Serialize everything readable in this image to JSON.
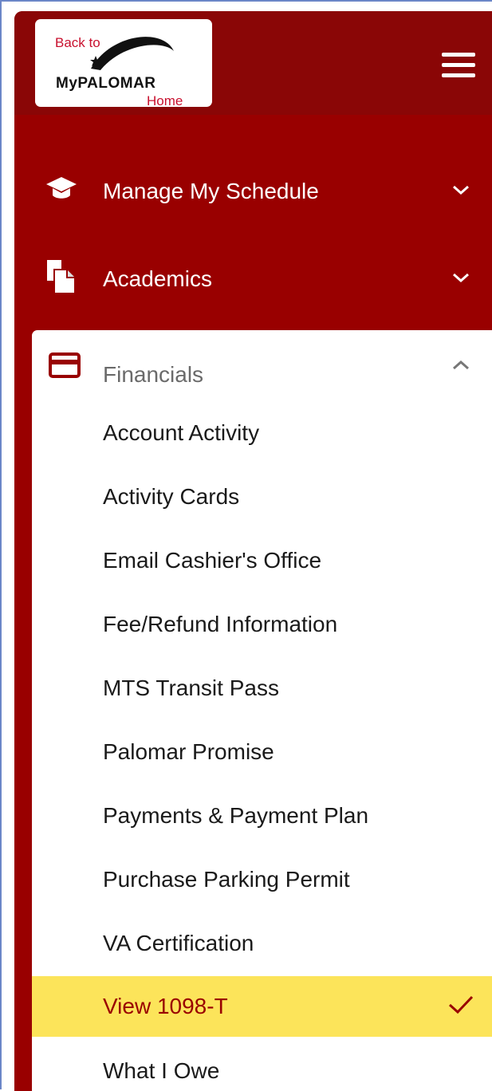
{
  "header": {
    "logo": {
      "line1": "Back to",
      "brand": "MyPALOMAR",
      "line3": "Home"
    },
    "menu_icon": "hamburger-menu-icon"
  },
  "nav": [
    {
      "label": "Manage My Schedule",
      "icon": "graduation-cap-icon",
      "expanded": false
    },
    {
      "label": "Academics",
      "icon": "documents-icon",
      "expanded": false
    },
    {
      "label": "Financials",
      "icon": "credit-card-icon",
      "expanded": true
    }
  ],
  "financials_items": [
    {
      "label": "Account Activity"
    },
    {
      "label": "Activity Cards"
    },
    {
      "label": "Email Cashier's Office"
    },
    {
      "label": "Fee/Refund Information"
    },
    {
      "label": "MTS Transit Pass"
    },
    {
      "label": "Palomar Promise"
    },
    {
      "label": "Payments & Payment Plan"
    },
    {
      "label": "Purchase Parking Permit"
    },
    {
      "label": "VA Certification"
    },
    {
      "label": "View 1098-T",
      "selected": true
    },
    {
      "label": "What I Owe"
    }
  ],
  "colors": {
    "sidebar": "#990000",
    "topbar": "#8a0606",
    "highlight": "#fce45a",
    "brand_red": "#c8102e"
  }
}
